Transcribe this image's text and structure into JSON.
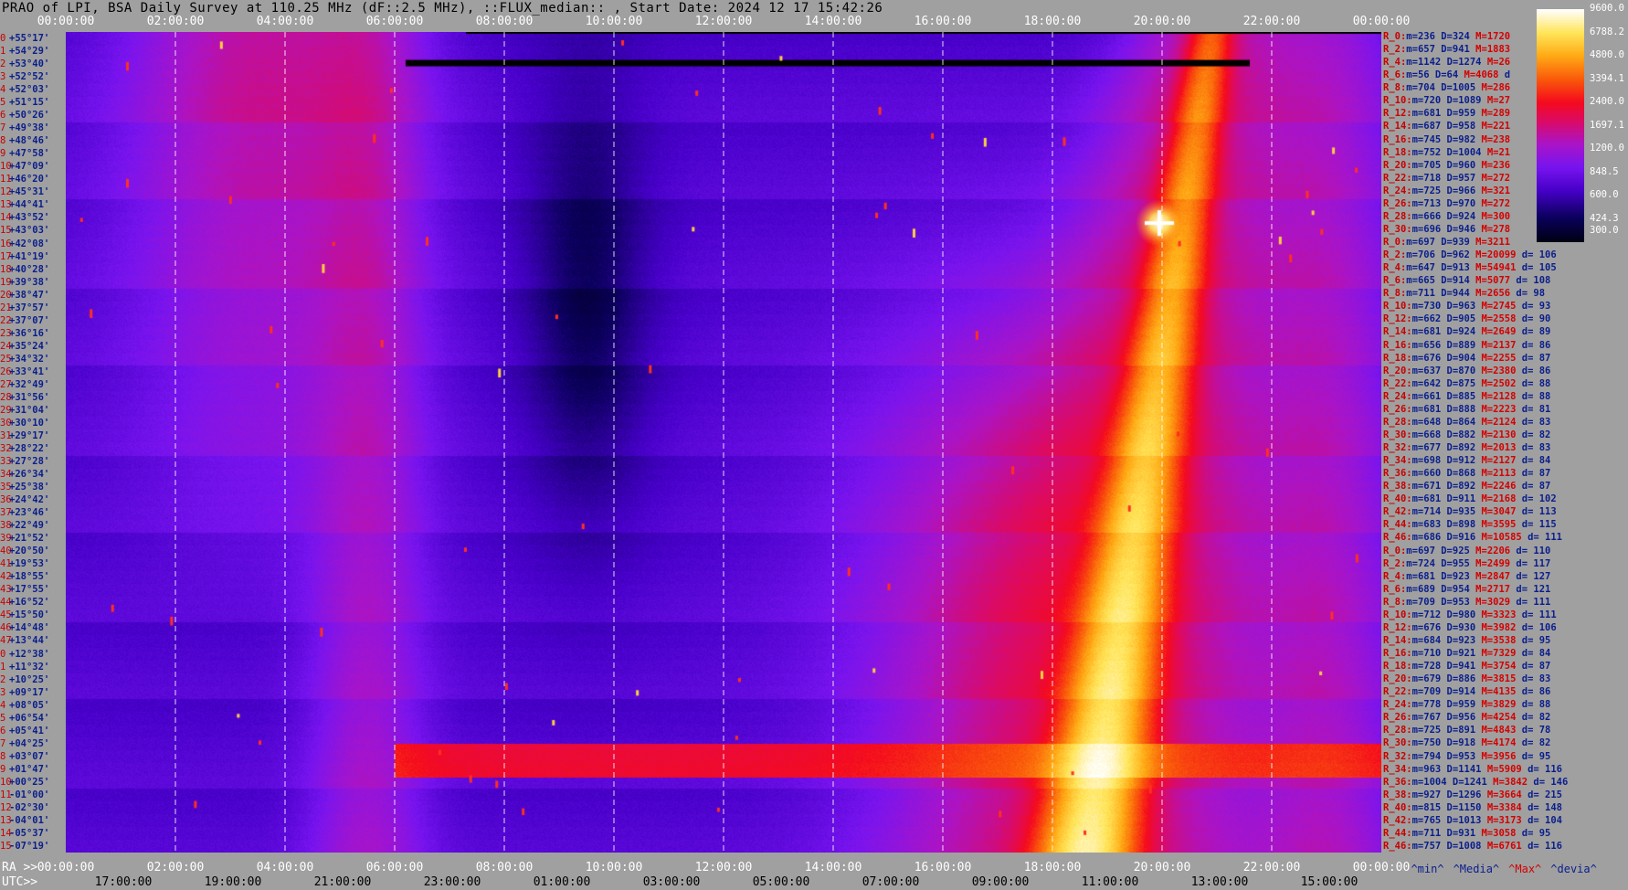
{
  "title": "PRAO of LPI, BSA Daily Survey at 110.25 MHz (dF::2.5 MHz), ::FLUX_median:: , Start Date: 2024 12 17 15:42:26",
  "time_axis": {
    "top_labels": [
      "00:00:00",
      "02:00:00",
      "04:00:00",
      "06:00:00",
      "08:00:00",
      "10:00:00",
      "12:00:00",
      "14:00:00",
      "16:00:00",
      "18:00:00",
      "20:00:00",
      "22:00:00",
      "00:00:00"
    ],
    "bottom_ra_prefix": "RA >>",
    "bottom_ra_labels": [
      "00:00:00",
      "02:00:00",
      "04:00:00",
      "06:00:00",
      "08:00:00",
      "10:00:00",
      "12:00:00",
      "14:00:00",
      "16:00:00",
      "18:00:00",
      "20:00:00",
      "22:00:00",
      "00:00:00"
    ],
    "bottom_utc_prefix": "UTC>>",
    "bottom_utc_labels": [
      "17:00:00",
      "19:00:00",
      "21:00:00",
      "23:00:00",
      "01:00:00",
      "03:00:00",
      "05:00:00",
      "07:00:00",
      "09:00:00",
      "11:00:00",
      "13:00:00",
      "15:00:00"
    ]
  },
  "declinations": [
    "+55°17'",
    "+54°29'",
    "+53°40'",
    "+52°52'",
    "+52°03'",
    "+51°15'",
    "+50°26'",
    "+49°38'",
    "+48°46'",
    "+47°58'",
    "+47°09'",
    "+46°20'",
    "+45°31'",
    "+44°41'",
    "+43°52'",
    "+43°03'",
    "+42°08'",
    "+41°19'",
    "+40°28'",
    "+39°38'",
    "+38°47'",
    "+37°57'",
    "+37°07'",
    "+36°16'",
    "+35°24'",
    "+34°32'",
    "+33°41'",
    "+32°49'",
    "+31°56'",
    "+31°04'",
    "+30°10'",
    "+29°17'",
    "+28°22'",
    "+27°28'",
    "+26°34'",
    "+25°38'",
    "+24°42'",
    "+23°46'",
    "+22°49'",
    "+21°52'",
    "+20°50'",
    "+19°53'",
    "+18°55'",
    "+17°55'",
    "+16°52'",
    "+15°50'",
    "+14°48'",
    "+13°44'",
    "+12°38'",
    "+11°32'",
    "+10°25'",
    "+09°17'",
    "+08°05'",
    "+06°54'",
    "+05°41'",
    "+04°25'",
    "+03°07'",
    "+01°47'",
    "+00°25'",
    "-01°00'",
    "-02°30'",
    "-04°01'",
    "-05°37'",
    "-07°19'"
  ],
  "stats": [
    {
      "r": "R_0:",
      "m": "m=236",
      "d": "D=324",
      "M": "M=1720",
      "dv": ""
    },
    {
      "r": "R_2:",
      "m": "m=657",
      "d": "D=941",
      "M": "M=1883",
      "dv": ""
    },
    {
      "r": "R_4:",
      "m": "m=1142",
      "d": "D=1274",
      "M": "M=26",
      "dv": ""
    },
    {
      "r": "R_6:",
      "m": "m=56",
      "d": "D=64",
      "M": "M=4068",
      "dv": "d"
    },
    {
      "r": "R_8:",
      "m": "m=704",
      "d": "D=1005",
      "M": "M=286",
      "dv": ""
    },
    {
      "r": "R_10:",
      "m": "m=720",
      "d": "D=1089",
      "M": "M=27",
      "dv": ""
    },
    {
      "r": "R_12:",
      "m": "m=681",
      "d": "D=959",
      "M": "M=289",
      "dv": ""
    },
    {
      "r": "R_14:",
      "m": "m=687",
      "d": "D=958",
      "M": "M=221",
      "dv": ""
    },
    {
      "r": "R_16:",
      "m": "m=745",
      "d": "D=982",
      "M": "M=238",
      "dv": ""
    },
    {
      "r": "R_18:",
      "m": "m=752",
      "d": "D=1004",
      "M": "M=21",
      "dv": ""
    },
    {
      "r": "R_20:",
      "m": "m=705",
      "d": "D=960",
      "M": "M=236",
      "dv": ""
    },
    {
      "r": "R_22:",
      "m": "m=718",
      "d": "D=957",
      "M": "M=272",
      "dv": ""
    },
    {
      "r": "R_24:",
      "m": "m=725",
      "d": "D=966",
      "M": "M=321",
      "dv": ""
    },
    {
      "r": "R_26:",
      "m": "m=713",
      "d": "D=970",
      "M": "M=272",
      "dv": ""
    },
    {
      "r": "R_28:",
      "m": "m=666",
      "d": "D=924",
      "M": "M=300",
      "dv": ""
    },
    {
      "r": "R_30:",
      "m": "m=696",
      "d": "D=946",
      "M": "M=278",
      "dv": ""
    },
    {
      "r": "R_0:",
      "m": "m=697",
      "d": "D=939",
      "M": "M=3211",
      "dv": ""
    },
    {
      "r": "R_2:",
      "m": "m=706",
      "d": "D=962",
      "M": "M=20099",
      "dv": "d= 106"
    },
    {
      "r": "R_4:",
      "m": "m=647",
      "d": "D=913",
      "M": "M=54941",
      "dv": "d= 105"
    },
    {
      "r": "R_6:",
      "m": "m=665",
      "d": "D=914",
      "M": "M=5077",
      "dv": "d= 108"
    },
    {
      "r": "R_8:",
      "m": "m=711",
      "d": "D=944",
      "M": "M=2656",
      "dv": "d= 98"
    },
    {
      "r": "R_10:",
      "m": "m=730",
      "d": "D=963",
      "M": "M=2745",
      "dv": "d= 93"
    },
    {
      "r": "R_12:",
      "m": "m=662",
      "d": "D=905",
      "M": "M=2558",
      "dv": "d= 90"
    },
    {
      "r": "R_14:",
      "m": "m=681",
      "d": "D=924",
      "M": "M=2649",
      "dv": "d= 89"
    },
    {
      "r": "R_16:",
      "m": "m=656",
      "d": "D=889",
      "M": "M=2137",
      "dv": "d= 86"
    },
    {
      "r": "R_18:",
      "m": "m=676",
      "d": "D=904",
      "M": "M=2255",
      "dv": "d= 87"
    },
    {
      "r": "R_20:",
      "m": "m=637",
      "d": "D=870",
      "M": "M=2380",
      "dv": "d= 86"
    },
    {
      "r": "R_22:",
      "m": "m=642",
      "d": "D=875",
      "M": "M=2502",
      "dv": "d= 88"
    },
    {
      "r": "R_24:",
      "m": "m=661",
      "d": "D=885",
      "M": "M=2128",
      "dv": "d= 88"
    },
    {
      "r": "R_26:",
      "m": "m=681",
      "d": "D=888",
      "M": "M=2223",
      "dv": "d= 81"
    },
    {
      "r": "R_28:",
      "m": "m=648",
      "d": "D=864",
      "M": "M=2124",
      "dv": "d= 83"
    },
    {
      "r": "R_30:",
      "m": "m=668",
      "d": "D=882",
      "M": "M=2130",
      "dv": "d= 82"
    },
    {
      "r": "R_32:",
      "m": "m=677",
      "d": "D=892",
      "M": "M=2013",
      "dv": "d= 83"
    },
    {
      "r": "R_34:",
      "m": "m=698",
      "d": "D=912",
      "M": "M=2127",
      "dv": "d= 84"
    },
    {
      "r": "R_36:",
      "m": "m=660",
      "d": "D=868",
      "M": "M=2113",
      "dv": "d= 87"
    },
    {
      "r": "R_38:",
      "m": "m=671",
      "d": "D=892",
      "M": "M=2246",
      "dv": "d= 87"
    },
    {
      "r": "R_40:",
      "m": "m=681",
      "d": "D=911",
      "M": "M=2168",
      "dv": "d= 102"
    },
    {
      "r": "R_42:",
      "m": "m=714",
      "d": "D=935",
      "M": "M=3047",
      "dv": "d= 113"
    },
    {
      "r": "R_44:",
      "m": "m=683",
      "d": "D=898",
      "M": "M=3595",
      "dv": "d= 115"
    },
    {
      "r": "R_46:",
      "m": "m=686",
      "d": "D=916",
      "M": "M=10585",
      "dv": "d= 111"
    },
    {
      "r": "R_0:",
      "m": "m=697",
      "d": "D=925",
      "M": "M=2206",
      "dv": "d= 110"
    },
    {
      "r": "R_2:",
      "m": "m=724",
      "d": "D=955",
      "M": "M=2499",
      "dv": "d= 117"
    },
    {
      "r": "R_4:",
      "m": "m=681",
      "d": "D=923",
      "M": "M=2847",
      "dv": "d= 127"
    },
    {
      "r": "R_6:",
      "m": "m=689",
      "d": "D=954",
      "M": "M=2717",
      "dv": "d= 121"
    },
    {
      "r": "R_8:",
      "m": "m=709",
      "d": "D=953",
      "M": "M=3029",
      "dv": "d= 111"
    },
    {
      "r": "R_10:",
      "m": "m=712",
      "d": "D=980",
      "M": "M=3323",
      "dv": "d= 111"
    },
    {
      "r": "R_12:",
      "m": "m=676",
      "d": "D=930",
      "M": "M=3982",
      "dv": "d= 106"
    },
    {
      "r": "R_14:",
      "m": "m=684",
      "d": "D=923",
      "M": "M=3538",
      "dv": "d= 95"
    },
    {
      "r": "R_16:",
      "m": "m=710",
      "d": "D=921",
      "M": "M=7329",
      "dv": "d= 84"
    },
    {
      "r": "R_18:",
      "m": "m=728",
      "d": "D=941",
      "M": "M=3754",
      "dv": "d= 87"
    },
    {
      "r": "R_20:",
      "m": "m=679",
      "d": "D=886",
      "M": "M=3815",
      "dv": "d= 83"
    },
    {
      "r": "R_22:",
      "m": "m=709",
      "d": "D=914",
      "M": "M=4135",
      "dv": "d= 86"
    },
    {
      "r": "R_24:",
      "m": "m=778",
      "d": "D=959",
      "M": "M=3829",
      "dv": "d= 88"
    },
    {
      "r": "R_26:",
      "m": "m=767",
      "d": "D=956",
      "M": "M=4254",
      "dv": "d= 82"
    },
    {
      "r": "R_28:",
      "m": "m=725",
      "d": "D=891",
      "M": "M=4843",
      "dv": "d= 78"
    },
    {
      "r": "R_30:",
      "m": "m=750",
      "d": "D=918",
      "M": "M=4174",
      "dv": "d= 82"
    },
    {
      "r": "R_32:",
      "m": "m=794",
      "d": "D=953",
      "M": "M=3956",
      "dv": "d= 95"
    },
    {
      "r": "R_34:",
      "m": "m=963",
      "d": "D=1141",
      "M": "M=5909",
      "dv": "d= 116"
    },
    {
      "r": "R_36:",
      "m": "m=1004",
      "d": "D=1241",
      "M": "M=3842",
      "dv": "d= 146"
    },
    {
      "r": "R_38:",
      "m": "m=927",
      "d": "D=1296",
      "M": "M=3664",
      "dv": "d= 215"
    },
    {
      "r": "R_40:",
      "m": "m=815",
      "d": "D=1150",
      "M": "M=3384",
      "dv": "d= 148"
    },
    {
      "r": "R_42:",
      "m": "m=765",
      "d": "D=1013",
      "M": "M=3173",
      "dv": "d= 104"
    },
    {
      "r": "R_44:",
      "m": "m=711",
      "d": "D=931",
      "M": "M=3058",
      "dv": "d= 95"
    },
    {
      "r": "R_46:",
      "m": "m=757",
      "d": "D=1008",
      "M": "M=6761",
      "dv": "d= 116"
    }
  ],
  "stats_footer": {
    "min": "^min^",
    "median": "^Media^",
    "max": "^Max^",
    "devia": "^devia^"
  },
  "colorbar": {
    "ticks": [
      "9600.0",
      "6788.2",
      "4800.0",
      "3394.1",
      "2400.0",
      "1697.1",
      "1200.0",
      "848.5",
      "600.0",
      "424.3",
      "300.0"
    ]
  },
  "chart_data": {
    "type": "heatmap",
    "title": "PRAO of LPI, BSA Daily Survey at 110.25 MHz (dF::2.5 MHz), ::FLUX_median:: , Start Date: 2024 12 17 15:42:26",
    "x_axis": {
      "quantity": "RA",
      "range": [
        "00:00:00",
        "24:00:00"
      ],
      "major_tick_hours": 2
    },
    "y_axis": {
      "quantity": "Declination",
      "range_deg": [
        55.28,
        -7.32
      ],
      "rows": 64
    },
    "color_scale": {
      "type": "log",
      "vmin": 300.0,
      "vmax": 9600.0
    },
    "features": [
      {
        "name": "galactic plane ridge",
        "ra_hours_at_dec_min": 18.6,
        "ra_hours_at_dec_max": 20.9,
        "peak_value": 6000
      },
      {
        "name": "bright point source",
        "ra_hours": 19.95,
        "dec_deg": 40.7,
        "peak_value": 9600
      },
      {
        "name": "horizontal bright band",
        "dec_deg_range": [
          -1.0,
          0.4
        ],
        "ra_hours_range": [
          6.0,
          24.0
        ],
        "value": 1800
      },
      {
        "name": "dark region",
        "ra_hours_range": [
          8.5,
          10.5
        ],
        "dec_deg_range": [
          20.0,
          50.0
        ],
        "value": 450
      },
      {
        "name": "masked black strip",
        "dec_deg": 52.87,
        "ra_hours_range": [
          6.2,
          21.6
        ]
      },
      {
        "name": "masked black strip",
        "dec_deg": 55.28,
        "ra_hours_range": [
          7.3,
          24.0
        ]
      }
    ],
    "grid": true
  }
}
